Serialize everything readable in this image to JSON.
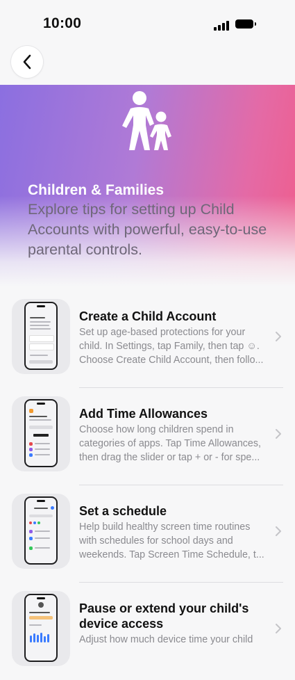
{
  "status_bar": {
    "time": "10:00"
  },
  "hero": {
    "title": "Children & Families",
    "description": "Explore tips for setting up Child Accounts with powerful, easy-to-use parental controls."
  },
  "items": [
    {
      "title": "Create a Child Account",
      "description": "Set up age-based protections for your child. In Settings, tap Family, then tap ☺. Choose Create Child Account, then follo..."
    },
    {
      "title": "Add Time Allowances",
      "description": "Choose how long children spend in categories of apps. Tap Time Allowances, then drag the slider or tap + or - for spe..."
    },
    {
      "title": "Set a schedule",
      "description": "Help build healthy screen time routines with schedules for school days and weekends. Tap Screen Time Schedule, t..."
    },
    {
      "title": "Pause or extend your child's device access",
      "description": "Adjust how much device time your child"
    }
  ]
}
